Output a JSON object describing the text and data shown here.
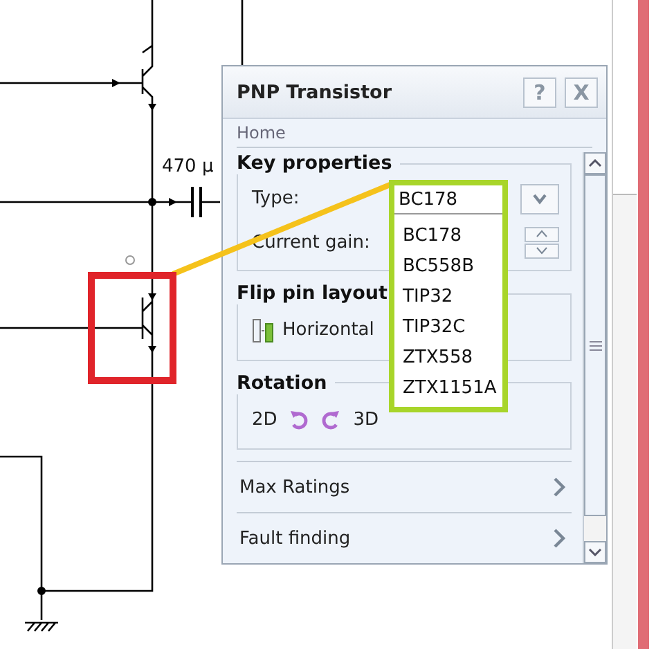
{
  "canvas": {
    "capacitor_label": "470 µ"
  },
  "panel": {
    "title": "PNP Transistor",
    "help": "?",
    "close": "X",
    "breadcrumb": "Home",
    "key_properties": {
      "heading": "Key properties",
      "type_label": "Type:",
      "type_value": "BC178",
      "gain_label": "Current gain:",
      "type_options": [
        "BC178",
        "BC558B",
        "TIP32",
        "TIP32C",
        "ZTX558",
        "ZTX1151A"
      ]
    },
    "flip_pin_layout": {
      "heading": "Flip pin layout",
      "option": "Horizontal"
    },
    "rotation": {
      "heading": "Rotation",
      "left": "2D",
      "right": "3D"
    },
    "sections": [
      {
        "label": "Max Ratings",
        "expanded": false
      },
      {
        "label": "Fault finding",
        "expanded": false
      }
    ]
  }
}
